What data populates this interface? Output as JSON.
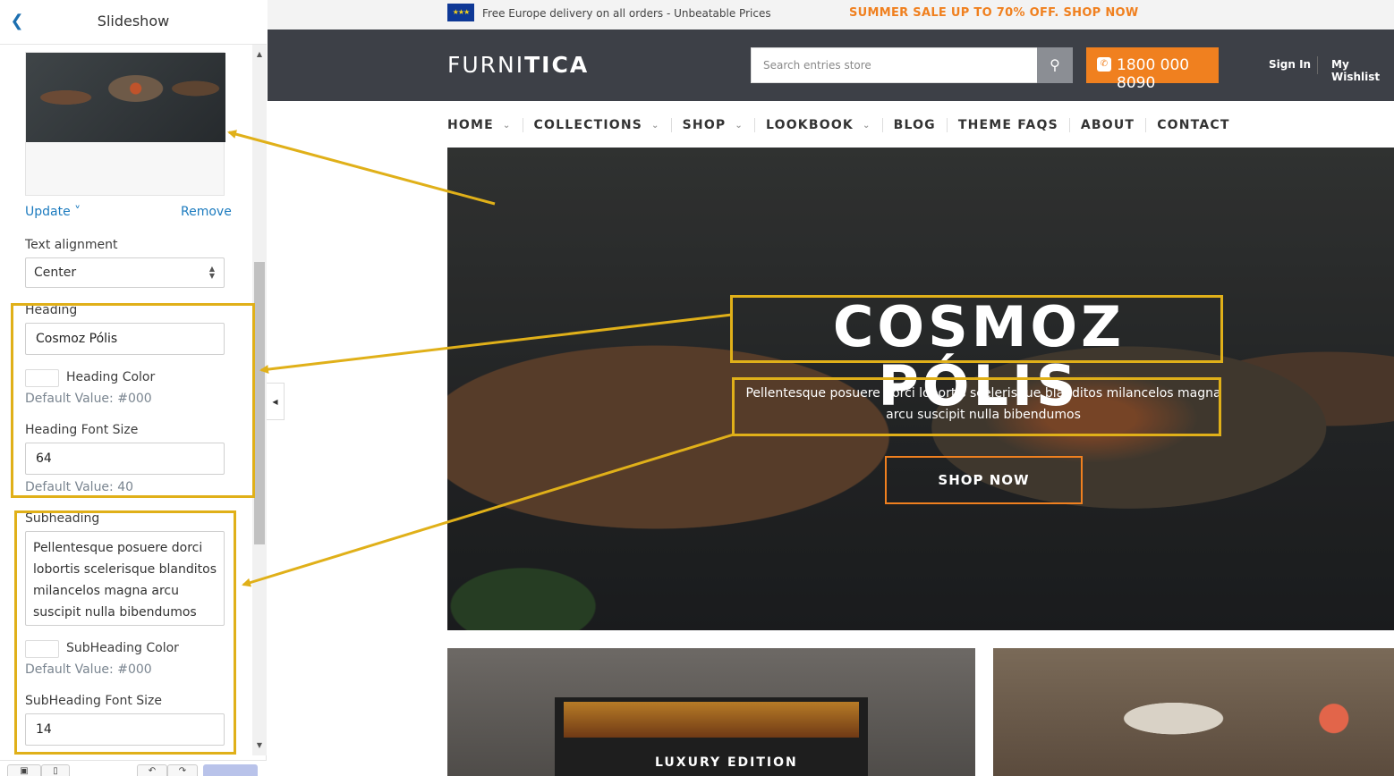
{
  "panel": {
    "title": "Slideshow",
    "back_icon": "chevron-left-icon",
    "update_label": "Update ˅",
    "remove_label": "Remove",
    "text_alignment_label": "Text alignment",
    "text_alignment_value": "Center",
    "heading_label": "Heading",
    "heading_value": "Cosmoz Pólis",
    "heading_color_label": "Heading Color",
    "heading_color_default": "Default Value: #000",
    "heading_font_size_label": "Heading Font Size",
    "heading_font_size_value": "64",
    "heading_font_size_default": "Default Value: 40",
    "subheading_label": "Subheading",
    "subheading_value": "Pellentesque posuere dorci lobortis scelerisque blanditos milancelos magna arcu suscipit nulla bibendumos",
    "subheading_color_label": "SubHeading Color",
    "subheading_color_default": "Default Value: #000",
    "subheading_font_size_label": "SubHeading Font Size",
    "subheading_font_size_value": "14"
  },
  "store": {
    "topbar_text": "Free Europe delivery on all orders - Unbeatable Prices",
    "topbar_promo": "SUMMER SALE UP TO 70% OFF. SHOP NOW",
    "logo_thin": "FURNI",
    "logo_bold": "TICA",
    "search_placeholder": "Search entries store",
    "phone": "1800 000 8090",
    "sign_in": "Sign In",
    "wishlist": "My Wishlist",
    "nav": [
      "HOME",
      "COLLECTIONS",
      "SHOP",
      "LOOKBOOK",
      "BLOG",
      "THEME FAQS",
      "ABOUT",
      "CONTACT"
    ],
    "hero_heading": "COSMOZ PÓLIS",
    "hero_subheading": "Pellentesque posuere dorci lobortis scelerisque blanditos milancelos magna arcu suscipit nulla bibendumos",
    "shop_now": "SHOP NOW",
    "card_label": "LUXURY EDITION"
  },
  "colors": {
    "accent_orange": "#f0801f",
    "link_blue": "#1c7bbf",
    "header_dark": "#3d4047",
    "annotation_yellow": "#e0b019"
  }
}
